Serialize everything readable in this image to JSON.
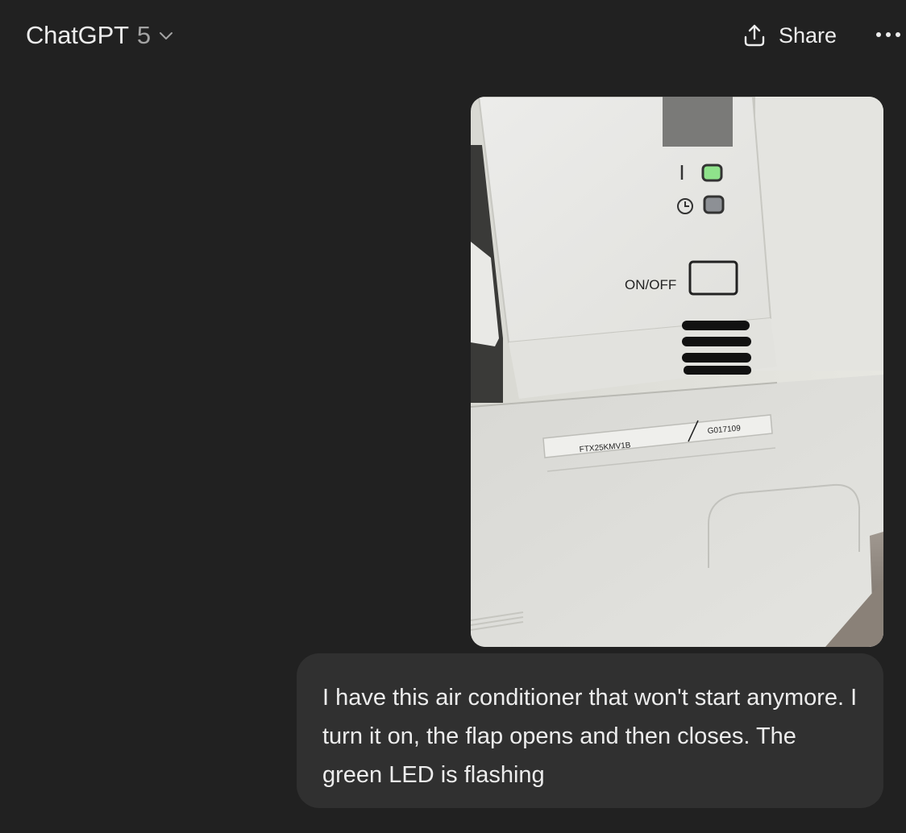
{
  "header": {
    "model_name": "ChatGPT",
    "model_version": "5",
    "share_label": "Share",
    "icons": {
      "model_dropdown": "chevron-down-icon",
      "share": "share-upload-icon",
      "more": "more-horizontal-icon"
    }
  },
  "conversation": {
    "messages": [
      {
        "role": "user",
        "attachment": {
          "kind": "photo",
          "labels": {
            "on_off": "ON/OFF",
            "model_code": "FTX25KMV1B",
            "serial_code": "G017109"
          }
        },
        "text": "I have this air conditioner that won't start anymore. I turn it on, the flap opens and then closes. The green LED is flashing"
      }
    ]
  },
  "colors": {
    "background": "#212121",
    "bubble": "#303030",
    "text": "#ececec",
    "muted_text": "#a3a3a3",
    "led_green": "#8fe38b"
  }
}
